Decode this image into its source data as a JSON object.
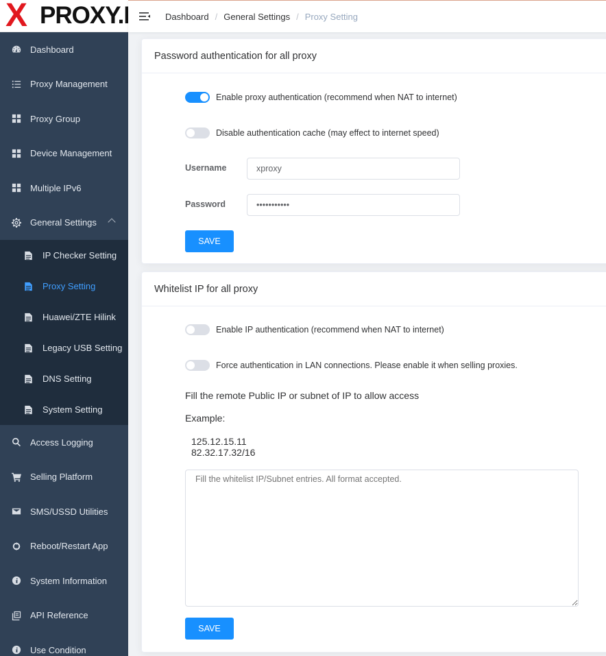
{
  "logo": {
    "x": "X",
    "text": "PROXY.IO"
  },
  "sidebar": {
    "items": [
      {
        "label": "Dashboard",
        "icon": "dashboard-icon"
      },
      {
        "label": "Proxy Management",
        "icon": "list-icon"
      },
      {
        "label": "Proxy Group",
        "icon": "grid-icon"
      },
      {
        "label": "Device Management",
        "icon": "grid-icon"
      },
      {
        "label": "Multiple IPv6",
        "icon": "grid-icon"
      },
      {
        "label": "General Settings",
        "icon": "gear-icon"
      }
    ],
    "submenu": [
      {
        "label": "IP Checker Setting",
        "icon": "document-icon"
      },
      {
        "label": "Proxy Setting",
        "icon": "document-icon"
      },
      {
        "label": "Huawei/ZTE Hilink",
        "icon": "document-icon"
      },
      {
        "label": "Legacy USB Setting",
        "icon": "document-icon"
      },
      {
        "label": "DNS Setting",
        "icon": "document-icon"
      },
      {
        "label": "System Setting",
        "icon": "document-icon"
      }
    ],
    "items_after": [
      {
        "label": "Access Logging",
        "icon": "search-icon"
      },
      {
        "label": "Selling Platform",
        "icon": "cart-icon"
      },
      {
        "label": "SMS/USSD Utilities",
        "icon": "mail-icon"
      },
      {
        "label": "Reboot/Restart App",
        "icon": "restart-icon"
      },
      {
        "label": "System Information",
        "icon": "info-icon"
      },
      {
        "label": "API Reference",
        "icon": "copy-icon"
      },
      {
        "label": "Use Condition",
        "icon": "info-icon"
      }
    ]
  },
  "breadcrumb": [
    "Dashboard",
    "General Settings",
    "Proxy Setting"
  ],
  "auth_card": {
    "title": "Password authentication for all proxy",
    "enable_auth_label": "Enable proxy authentication (recommend when NAT to internet)",
    "enable_auth_on": true,
    "disable_cache_label": "Disable authentication cache (may effect to internet speed)",
    "disable_cache_on": false,
    "username_label": "Username",
    "username_value": "xproxy",
    "password_label": "Password",
    "password_value": "•••••••••••",
    "save_label": "SAVE"
  },
  "whitelist_card": {
    "title": "Whitelist IP for all proxy",
    "enable_ip_auth_label": "Enable IP authentication (recommend when NAT to internet)",
    "enable_ip_auth_on": false,
    "force_lan_label": "Force authentication in LAN connections. Please enable it when selling proxies.",
    "force_lan_on": false,
    "instruction": "Fill the remote Public IP or subnet of IP to allow access",
    "example_label": "Example:",
    "examples": [
      "125.12.15.11",
      "82.32.17.32/16"
    ],
    "textarea_placeholder": "Fill the whitelist IP/Subnet entries. All format accepted.",
    "save_label": "SAVE"
  },
  "colors": {
    "sidebar_bg": "#304156",
    "submenu_bg": "#1f2d3d",
    "accent": "#1890ff",
    "active_menu": "#409eff",
    "logo_red": "#e1181e"
  }
}
